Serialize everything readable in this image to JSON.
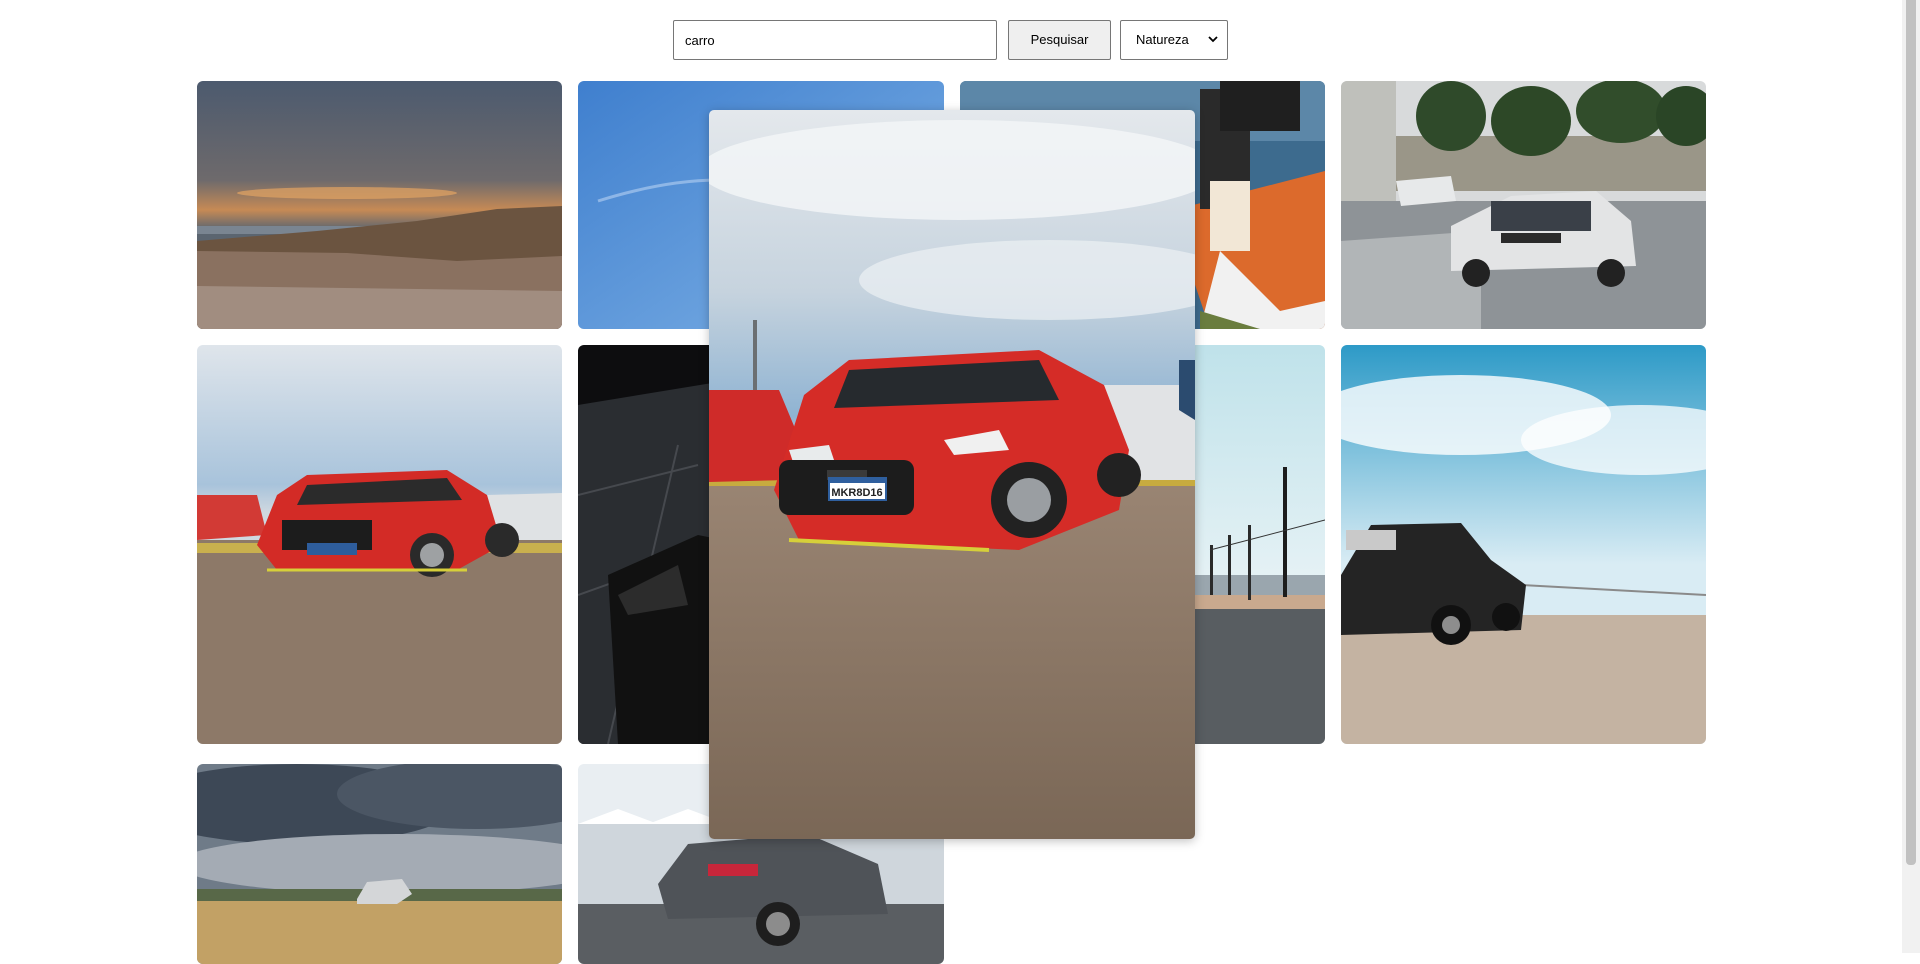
{
  "search": {
    "value": "carro",
    "button_label": "Pesquisar",
    "category": "Natureza"
  },
  "gallery": {
    "images": [
      "sunset-rocky-coast",
      "blue-sky",
      "boats-outboard-engine",
      "rally-car-street",
      "red-hatchback-parking",
      "black-car-dark-floor",
      "power-lines-road",
      "black-sedan-dragstrip",
      "pickup-truck-wheat-field",
      "grey-hatchback-event"
    ]
  },
  "modal": {
    "image": "red-hatchback-parking",
    "plate_text": "MKR8D16"
  }
}
